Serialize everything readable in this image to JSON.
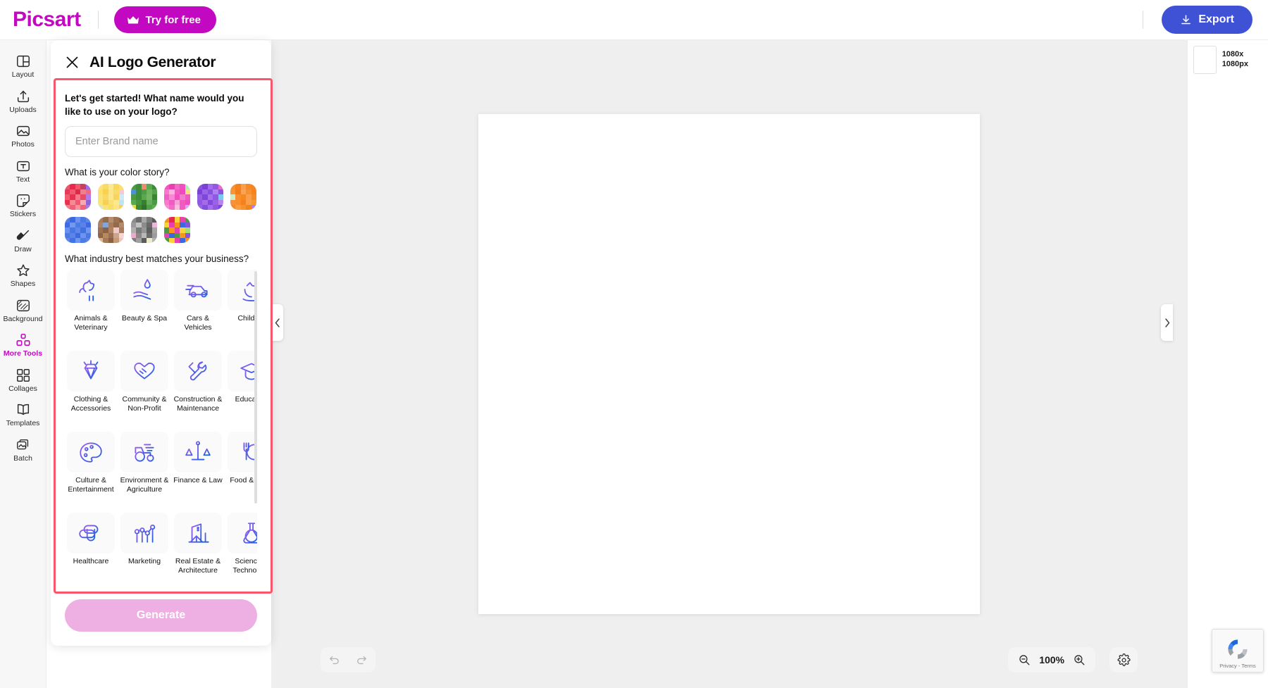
{
  "topbar": {
    "brand": "Picsart",
    "try_free_label": "Try for free",
    "export_label": "Export",
    "accent_magenta": "#c209c1",
    "export_blue": "#3f51d4"
  },
  "sidebar": {
    "active": "More Tools",
    "items": [
      {
        "label": "Layout",
        "icon": "layout-icon"
      },
      {
        "label": "Uploads",
        "icon": "upload-icon"
      },
      {
        "label": "Photos",
        "icon": "photo-icon"
      },
      {
        "label": "Text",
        "icon": "text-icon"
      },
      {
        "label": "Stickers",
        "icon": "sticker-icon"
      },
      {
        "label": "Draw",
        "icon": "brush-icon"
      },
      {
        "label": "Shapes",
        "icon": "star-icon"
      },
      {
        "label": "Background",
        "icon": "background-icon"
      },
      {
        "label": "More Tools",
        "icon": "more-tools-icon"
      },
      {
        "label": "Collages",
        "icon": "collage-icon"
      },
      {
        "label": "Templates",
        "icon": "template-icon"
      },
      {
        "label": "Batch",
        "icon": "batch-icon"
      }
    ]
  },
  "panel": {
    "title": "AI Logo Generator",
    "close_icon": "close-icon",
    "highlight_color": "#f8566c",
    "name_question": "Let's get started! What name would you like to use on your logo?",
    "brand_placeholder": "Enter Brand name",
    "brand_value": "",
    "color_question": "What is your color story?",
    "industry_question": "What industry best matches your business?",
    "generate_label": "Generate",
    "generate_color": "#eeb0e2"
  },
  "color_stories": [
    {
      "name": "red-pink-palette",
      "tiles": [
        "#f0546e",
        "#e8294e",
        "#f2556b",
        "#c8405f",
        "#a06ee8",
        "#e63a5c",
        "#ef5a72",
        "#e02848",
        "#ef7f8c",
        "#f06a7f",
        "#f25c72",
        "#e8304f",
        "#f3798c",
        "#e94a66",
        "#b47be6",
        "#e7days",
        "#f58a96",
        "#f05873",
        "#f9a9ae",
        "#8f63d8",
        "#f27d8d",
        "#ef6276",
        "#f5949e",
        "#f0627a",
        "#aa78e2"
      ]
    },
    {
      "name": "yellow-pastel-palette",
      "tiles": [
        "#fbe27a",
        "#f9db63",
        "#fde98f",
        "#f8d75c",
        "#fae06f",
        "#fce06d",
        "#f7d24f",
        "#fbe589",
        "#f9dc68",
        "#f5c9d6",
        "#fde27c",
        "#f9d95f",
        "#fce68b",
        "#f8d45a",
        "#cfe9f5",
        "#fbe378",
        "#f6cf55",
        "#fae071",
        "#fce98f",
        "#bfe3f2",
        "#cfe9c9",
        "#fae075",
        "#f9dd66",
        "#fce585",
        "#f6d15a"
      ]
    },
    {
      "name": "green-forest-palette",
      "tiles": [
        "#4a9b44",
        "#3f8c3a",
        "#f08a6a",
        "#5aa84f",
        "#3d8a38",
        "#4b90d8",
        "#3f8c3a",
        "#4f9e47",
        "#6fb55e",
        "#56a14c",
        "#4c9a45",
        "#3e8b39",
        "#5aa84f",
        "#74b863",
        "#3a8535",
        "#5aa84f",
        "#47963f",
        "#38802f",
        "#65b05a",
        "#4b9a45",
        "#f0d93a",
        "#3d8a38",
        "#2f7428",
        "#52a049",
        "#5fae52"
      ]
    },
    {
      "name": "magenta-pink-palette",
      "tiles": [
        "#f256c2",
        "#ea3fb0",
        "#f469c8",
        "#f04fbd",
        "#a9eeb5",
        "#f876cc",
        "#f9b4de",
        "#f25ac3",
        "#ef4bba",
        "#f9e07a",
        "#f060c4",
        "#f888d2",
        "#f04fbd",
        "#f47ccd",
        "#ef5cc0",
        "#f979cc",
        "#f05bc2",
        "#f8a0d8",
        "#f25ac3",
        "#ef4fbc",
        "#f58fd4",
        "#f36bc7",
        "#f9bde2",
        "#f05cc1",
        "#d8a8f0"
      ]
    },
    {
      "name": "purple-violet-palette",
      "tiles": [
        "#8a52e0",
        "#7b3fd6",
        "#a06ce8",
        "#9258e4",
        "#e06ed0",
        "#7c41d8",
        "#9b63e6",
        "#8650e2",
        "#b07ff0",
        "#8a52e0",
        "#9660e5",
        "#7f46da",
        "#a870ea",
        "#9158e3",
        "#7cc9f0",
        "#8f57e2",
        "#a66ce8",
        "#8248dd",
        "#9a62e5",
        "#b984f0",
        "#9a62e5",
        "#8350de",
        "#a86ee9",
        "#9058e3",
        "#7f46da"
      ]
    },
    {
      "name": "orange-warm-palette",
      "tiles": [
        "#f79030",
        "#f5801e",
        "#fa9e4a",
        "#f78a28",
        "#f6851f",
        "#f89535",
        "#f57c1a",
        "#fba455",
        "#f79030",
        "#f6841e",
        "#cfe9c9",
        "#f98f2e",
        "#f58820",
        "#faa04c",
        "#f68a26",
        "#f7923a",
        "#f88e2c",
        "#f5801e",
        "#f9a04b",
        "#f79834",
        "#f58a22",
        "#fa9e45",
        "#f8912f",
        "#f5811f",
        "#b07ff0"
      ]
    },
    {
      "name": "blue-palette",
      "tiles": [
        "#4f7de8",
        "#3c67de",
        "#6b92ee",
        "#4a78e5",
        "#5e86ea",
        "#3f6ae0",
        "#7398f0",
        "#4d7be6",
        "#5a83e9",
        "#3d68df",
        "#6a91ed",
        "#4876e4",
        "#5f87eb",
        "#4170e1",
        "#7095ef",
        "#4c79e5",
        "#5b84e9",
        "#3e69e0",
        "#6c93ee",
        "#4977e4",
        "#6088eb",
        "#4271e2",
        "#7196ef",
        "#4d7ae6",
        "#5c85ea"
      ]
    },
    {
      "name": "brown-earth-palette",
      "tiles": [
        "#a87c5c",
        "#956b4e",
        "#b88f6e",
        "#9e7354",
        "#8e6348",
        "#b08462",
        "#7fa8d8",
        "#a87c5c",
        "#946a4d",
        "#b58a69",
        "#9d7253",
        "#8c6246",
        "#af8360",
        "#f0c8c8",
        "#a97d5d",
        "#8f6549",
        "#b6895f",
        "#9b7051",
        "#caa58a",
        "#f4d6d6",
        "#d9b694",
        "#a47a58",
        "#8b6045",
        "#c49a78",
        "#f0c4c4"
      ]
    },
    {
      "name": "grey-monochrome-palette",
      "tiles": [
        "#8c8c8c",
        "#6e6e6e",
        "#a8a8a8",
        "#7d7d7d",
        "#5a5a5a",
        "#9a9a9a",
        "#c2c2c2",
        "#8c8c8c",
        "#6a6a6a",
        "#e8b8d8",
        "#b0b0b0",
        "#7a7a7a",
        "#969696",
        "#5f5f5f",
        "#a5a5a5",
        "#f0a8d0",
        "#888888",
        "#b8b8b8",
        "#6c6c6c",
        "#9c9c9c",
        "#7e7e7e",
        "#a0a0a0",
        "#5c5c5c",
        "#ececd0",
        "#b4b4b4"
      ]
    },
    {
      "name": "multicolor-bright-palette",
      "tiles": [
        "#f7941e",
        "#e8294e",
        "#f7d33a",
        "#ea3fb0",
        "#4a9b44",
        "#f7d33a",
        "#ea3fb0",
        "#f7941e",
        "#3c67de",
        "#8a52e0",
        "#4a9b44",
        "#f7941e",
        "#ea3fb0",
        "#f7d33a",
        "#9be07a",
        "#ea3fb0",
        "#3c67de",
        "#4a9b44",
        "#f7941e",
        "#8a52e0",
        "#4a9b44",
        "#f7d33a",
        "#ea3fb0",
        "#3c67de",
        "#f7941e"
      ]
    }
  ],
  "industries": [
    {
      "label": "Animals & Veterinary",
      "icon": "dog-cat-icon"
    },
    {
      "label": "Beauty & Spa",
      "icon": "hand-droplet-icon"
    },
    {
      "label": "Cars & Vehicles",
      "icon": "car-icon"
    },
    {
      "label": "Children",
      "icon": "rocking-horse-icon"
    },
    {
      "label": "Clothing & Accessories",
      "icon": "diamond-icon"
    },
    {
      "label": "Community & Non-Profit",
      "icon": "heart-hands-icon"
    },
    {
      "label": "Construction & Maintenance",
      "icon": "hammer-wrench-icon"
    },
    {
      "label": "Education",
      "icon": "graduation-cap-icon"
    },
    {
      "label": "Culture & Entertainment",
      "icon": "paint-palette-icon"
    },
    {
      "label": "Environment & Agriculture",
      "icon": "tractor-icon"
    },
    {
      "label": "Finance & Law",
      "icon": "scales-icon"
    },
    {
      "label": "Food & Drink",
      "icon": "fork-plate-icon"
    },
    {
      "label": "Healthcare",
      "icon": "medical-cross-icon"
    },
    {
      "label": "Marketing",
      "icon": "chart-graph-icon"
    },
    {
      "label": "Real Estate & Architecture",
      "icon": "building-house-icon"
    },
    {
      "label": "Science & Technology",
      "icon": "flask-icon"
    }
  ],
  "right_panel": {
    "page_size": "1080x 1080px",
    "thumb_name": "page-thumbnail"
  },
  "bottom": {
    "undo_icon": "undo-icon",
    "redo_icon": "redo-icon",
    "zoom_out_icon": "zoom-out-icon",
    "zoom_in_icon": "zoom-in-icon",
    "zoom_value": "100%",
    "settings_icon": "gear-icon",
    "recaptcha_text": "Privacy - Terms"
  }
}
